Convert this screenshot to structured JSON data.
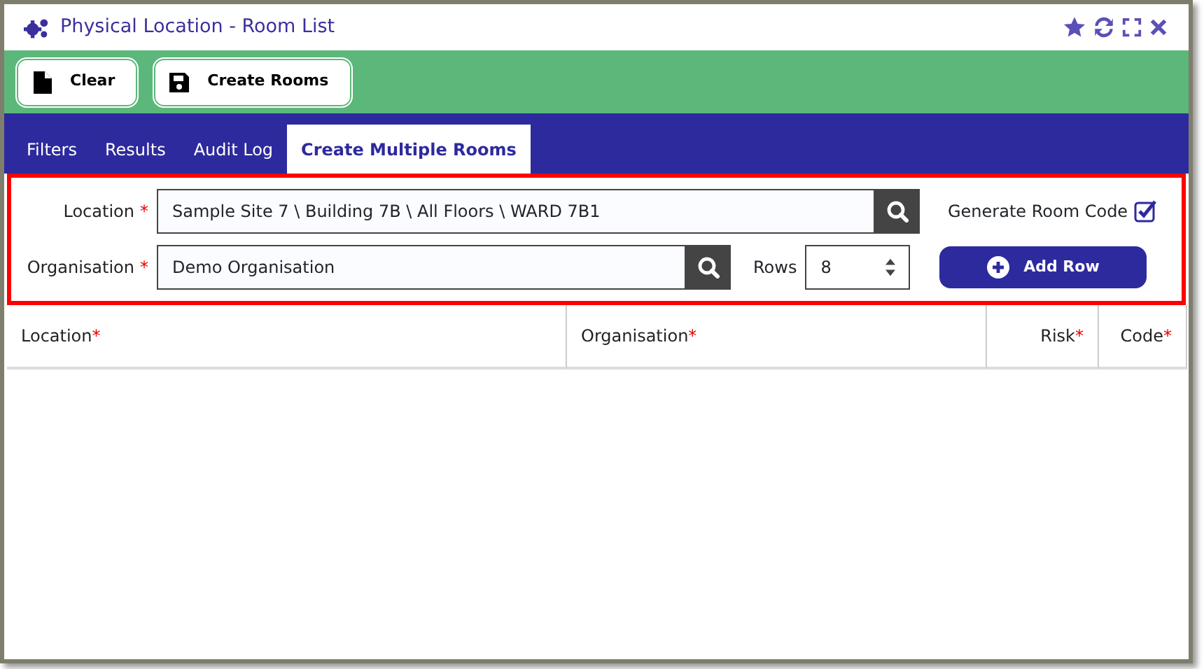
{
  "window": {
    "title": "Physical Location - Room List"
  },
  "toolbar": {
    "buttons": [
      {
        "label": "Clear",
        "kind": "new"
      },
      {
        "label": "Create Rooms",
        "kind": "save"
      }
    ]
  },
  "tabs": [
    {
      "label": "Filters",
      "selected": false
    },
    {
      "label": "Results",
      "selected": false
    },
    {
      "label": "Audit Log",
      "selected": false
    },
    {
      "label": "Create Multiple Rooms",
      "selected": true
    }
  ],
  "form": {
    "location": {
      "label": "Location",
      "required_mark": "*",
      "value": "Sample Site 7 \\ Building 7B \\ All Floors \\ WARD 7B1"
    },
    "organisation": {
      "label": "Organisation",
      "required_mark": "*",
      "value": "Demo Organisation"
    },
    "rows": {
      "label": "Rows",
      "value": "8"
    },
    "generate_room_code": {
      "label": "Generate Room Code",
      "checked": true
    },
    "add_row_button": {
      "label": "Add Row"
    }
  },
  "table": {
    "columns": [
      {
        "label": "Location",
        "required_mark": "*"
      },
      {
        "label": "Organisation",
        "required_mark": "*"
      },
      {
        "label": "Risk",
        "required_mark": "*"
      },
      {
        "label": "Code",
        "required_mark": "*"
      }
    ]
  }
}
